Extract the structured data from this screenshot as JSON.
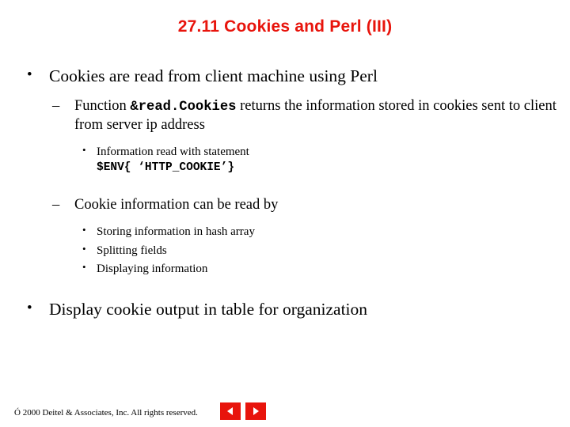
{
  "slide": {
    "title": "27.11 Cookies and Perl (III)",
    "bullets": {
      "b1": "Cookies are read from client machine using Perl",
      "b1_sub1_pre": "Function ",
      "b1_sub1_code": "&read.Cookies",
      "b1_sub1_post": " returns the information stored in cookies sent to client from server ip address",
      "b1_sub1_sub1": "Information read with statement",
      "b1_sub1_sub1_code": "$ENV{ ‘HTTP_COOKIE’}",
      "b1_sub2": "Cookie information can be read by",
      "b1_sub2_items": [
        "Storing information in hash array",
        "Splitting fields",
        "Displaying information"
      ],
      "b2": "Display cookie output in table for organization"
    },
    "bullet_glyphs": {
      "level1": "•",
      "level2": "–",
      "level3": "•"
    },
    "footer": "Ó 2000 Deitel & Associates, Inc.  All rights reserved.",
    "nav": {
      "prev_label": "previous-slide",
      "next_label": "next-slide"
    },
    "colors": {
      "title": "#e8140c",
      "nav": "#e8140c",
      "text": "#000000",
      "background": "#ffffff"
    }
  }
}
